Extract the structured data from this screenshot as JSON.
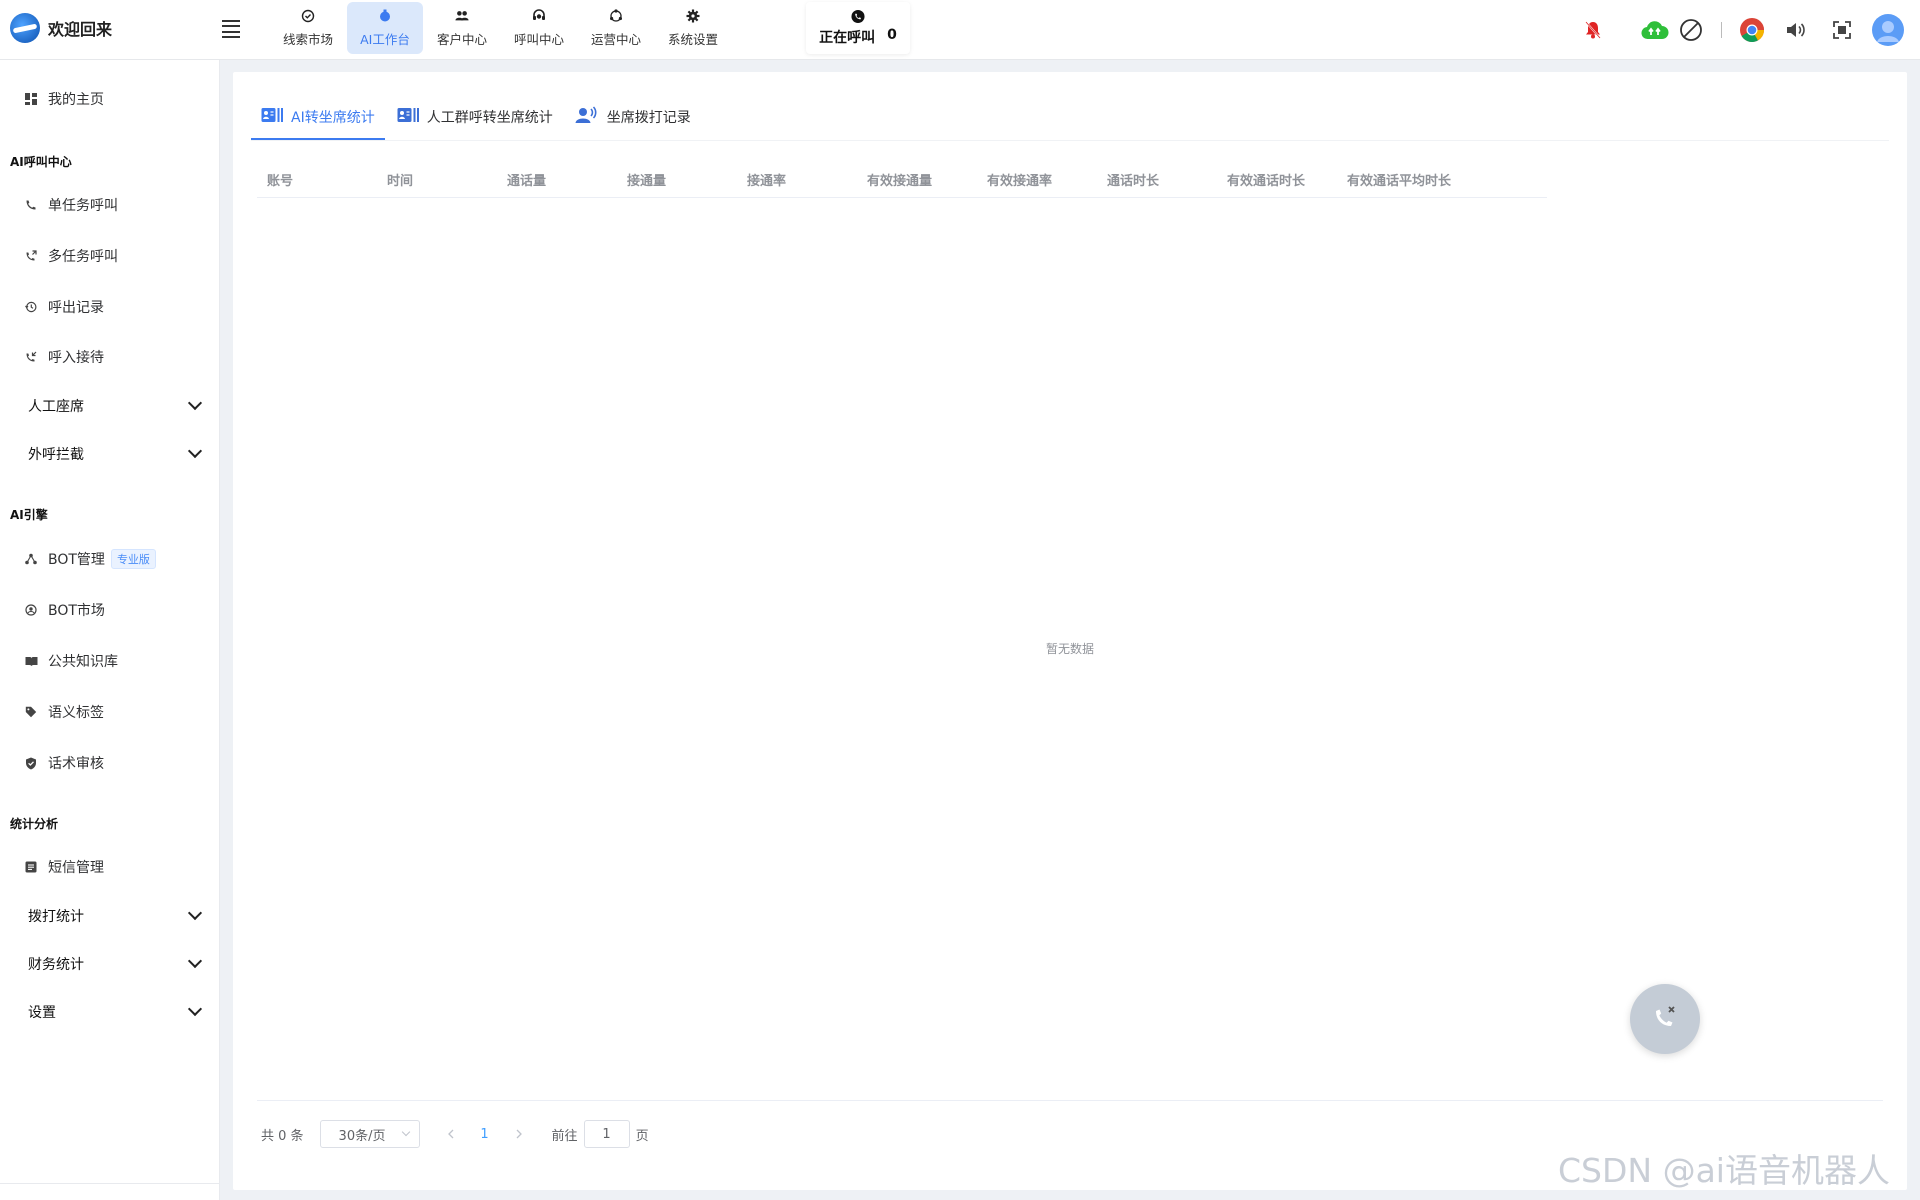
{
  "header": {
    "brand": "欢迎回来",
    "nav": [
      {
        "label": "线索市场",
        "icon": "check-circle-icon"
      },
      {
        "label": "AI工作台",
        "icon": "ai-dot-icon",
        "active": true
      },
      {
        "label": "客户中心",
        "icon": "users-icon"
      },
      {
        "label": "呼叫中心",
        "icon": "headset-icon"
      },
      {
        "label": "运营中心",
        "icon": "cycle-icon"
      },
      {
        "label": "系统设置",
        "icon": "gear-icon"
      }
    ],
    "calling": {
      "label": "正在呼叫",
      "count": "0"
    },
    "tools": [
      "bell-off-icon",
      "cloud-upload-icon",
      "block-icon",
      "chrome-icon",
      "volume-icon",
      "fullscreen-icon",
      "avatar"
    ]
  },
  "sidebar": {
    "home": "我的主页",
    "sections": {
      "call_center": "AI呼叫中心",
      "ai_engine": "AI引擎",
      "stats": "统计分析"
    },
    "items": {
      "single_call": "单任务呼叫",
      "multi_call": "多任务呼叫",
      "outbound_log": "呼出记录",
      "inbound": "呼入接待",
      "manual_seat": "人工座席",
      "block": "外呼拦截",
      "bot_mgmt": "BOT管理",
      "bot_pro_tag": "专业版",
      "bot_market": "BOT市场",
      "knowledge": "公共知识库",
      "semantic": "语义标签",
      "script_review": "话术审核",
      "sms": "短信管理",
      "dial_stats": "拨打统计",
      "finance_stats": "财务统计",
      "settings": "设置"
    }
  },
  "tabs": [
    {
      "label": "AI转坐席统计",
      "active": true
    },
    {
      "label": "人工群呼转坐席统计"
    },
    {
      "label": "坐席拨打记录"
    }
  ],
  "table": {
    "columns": [
      "账号",
      "时间",
      "通话量",
      "接通量",
      "接通率",
      "有效接通量",
      "有效接通率",
      "通话时长",
      "有效通话时长",
      "有效通话平均时长"
    ],
    "empty_text": "暂无数据"
  },
  "pagination": {
    "total_label": "共 0 条",
    "page_size": "30条/页",
    "current_page": "1",
    "goto_label": "前往",
    "goto_value": "1",
    "page_suffix": "页"
  },
  "watermark": "CSDN @ai语音机器人",
  "colors": {
    "accent": "#3c7bf0",
    "active_nav_bg": "#dbe8fb",
    "bell": "#e02424",
    "cloud": "#2fbf3a"
  }
}
